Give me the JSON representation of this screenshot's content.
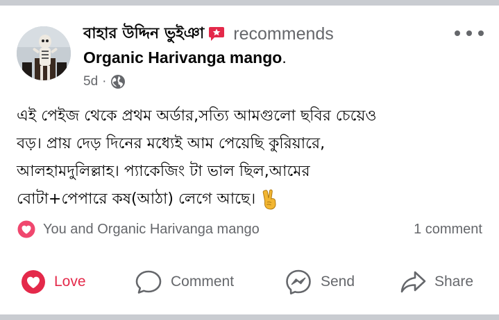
{
  "post": {
    "author_name": "বাহার উদ্দিন ভুইঞা",
    "recommends_text": "recommends",
    "page_name": "Organic Harivanga mango",
    "page_name_suffix": ".",
    "time": "5d",
    "meta_separator": "·",
    "privacy_icon": "globe-icon",
    "text_lines": [
      "এই পেইজ থেকে প্রথম অর্ডার,সত্যি আমগুলো ছবির চেয়েও",
      "বড়। প্রায় দেড় দিনের মধ্যেই আম পেয়েছি কুরিয়ারে,",
      "আলহামদুলিল্লাহ। প্যাকেজিং টা ভাল ছিল,আমের",
      "বোটা+পেপারে কষ(আঠা) লেগে আছে।"
    ],
    "emoji": "victory-hand-emoji"
  },
  "reactions": {
    "icon": "love-reaction-icon",
    "text": "You and Organic Harivanga mango",
    "comments": "1 comment"
  },
  "actions": {
    "love": "Love",
    "comment": "Comment",
    "send": "Send",
    "share": "Share"
  },
  "colors": {
    "love_red": "#e4294a",
    "secondary_text": "#65676b",
    "background_gray": "#c9ccd1"
  }
}
